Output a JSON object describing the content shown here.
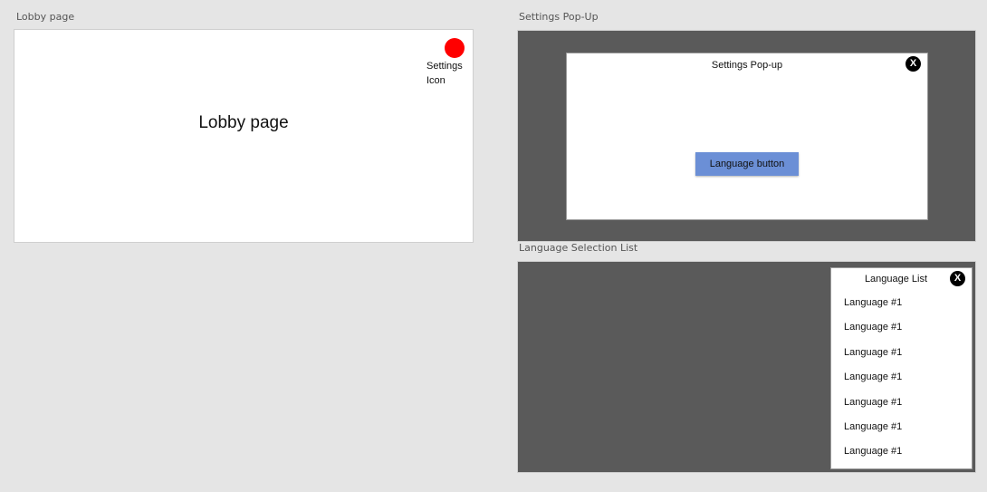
{
  "frames": {
    "lobby_label": "Lobby page",
    "settings_label": "Settings Pop-Up",
    "language_label": "Language Selection List"
  },
  "lobby": {
    "title": "Lobby page",
    "settings_icon_label": "Settings Icon",
    "settings_icon_color": "#ff0000"
  },
  "settings_popup": {
    "title": "Settings Pop-up",
    "close_label": "X",
    "language_button_label": "Language button",
    "language_button_color": "#6b8fd6"
  },
  "language_list": {
    "title": "Language List",
    "close_label": "X",
    "items": [
      {
        "label": "Language #1"
      },
      {
        "label": "Language #1"
      },
      {
        "label": "Language #1"
      },
      {
        "label": "Language #1"
      },
      {
        "label": "Language #1"
      },
      {
        "label": "Language #1"
      },
      {
        "label": "Language #1"
      }
    ]
  },
  "colors": {
    "canvas": "#e5e5e5",
    "overlay": "#5a5a5a",
    "card": "#ffffff"
  }
}
